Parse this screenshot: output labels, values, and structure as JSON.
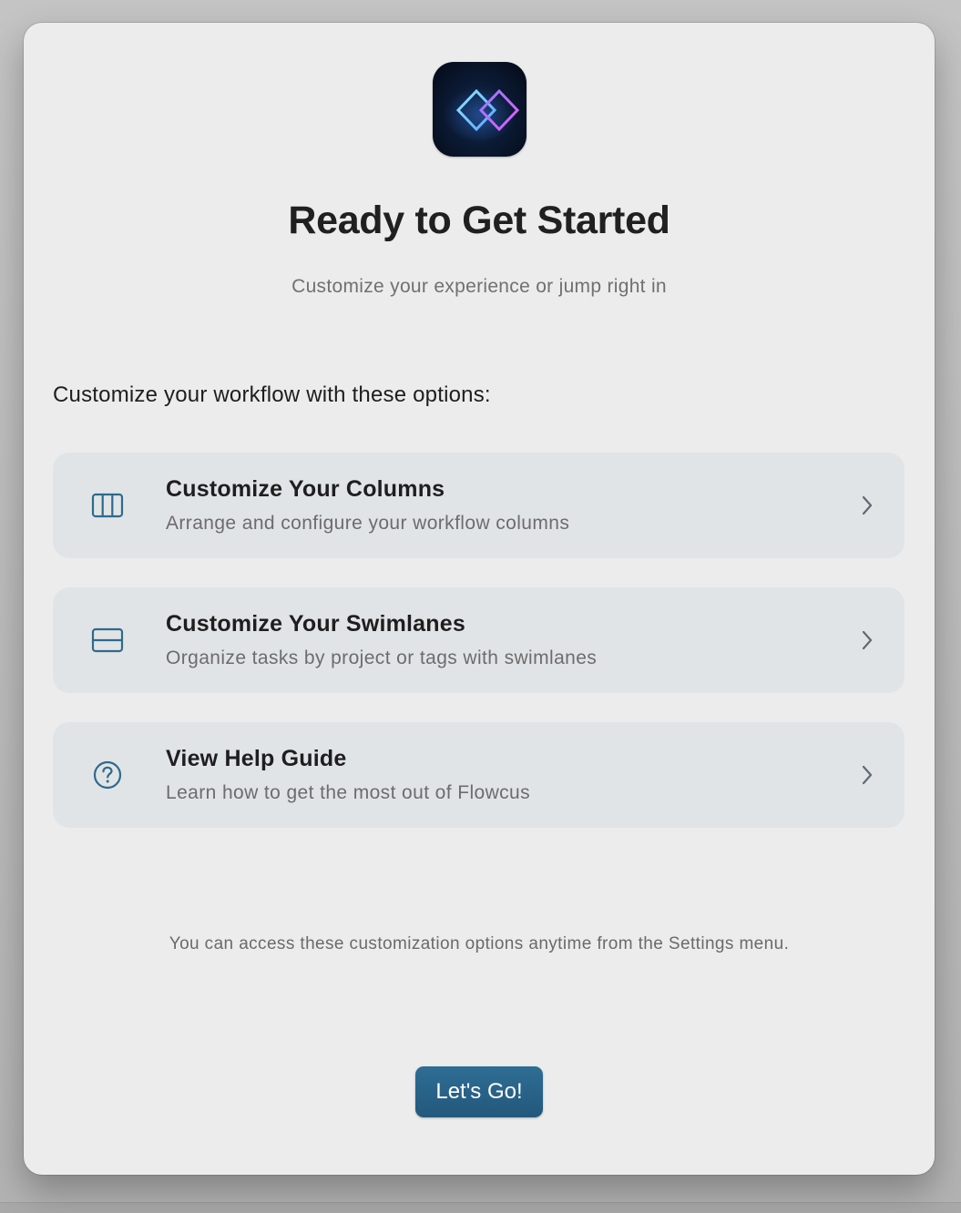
{
  "dialog": {
    "app_icon": "flowcus-infinity-diamonds-icon",
    "title": "Ready to Get Started",
    "subtitle": "Customize your experience or jump right in",
    "section_heading": "Customize your workflow with these options:",
    "options": [
      {
        "icon": "columns-icon",
        "title": "Customize Your Columns",
        "description": "Arrange and configure your workflow columns"
      },
      {
        "icon": "swimlanes-icon",
        "title": "Customize Your Swimlanes",
        "description": "Organize tasks by project or tags with swimlanes"
      },
      {
        "icon": "help-circle-icon",
        "title": "View Help Guide",
        "description": "Learn how to get the most out of Flowcus"
      }
    ],
    "footnote": "You can access these customization options anytime from the Settings menu.",
    "primary_button": "Let's Go!"
  },
  "colors": {
    "accent": "#2a6387",
    "icon_stroke": "#2e6a8c",
    "card_background": "#e1e4e6",
    "dialog_background": "#ececec"
  }
}
